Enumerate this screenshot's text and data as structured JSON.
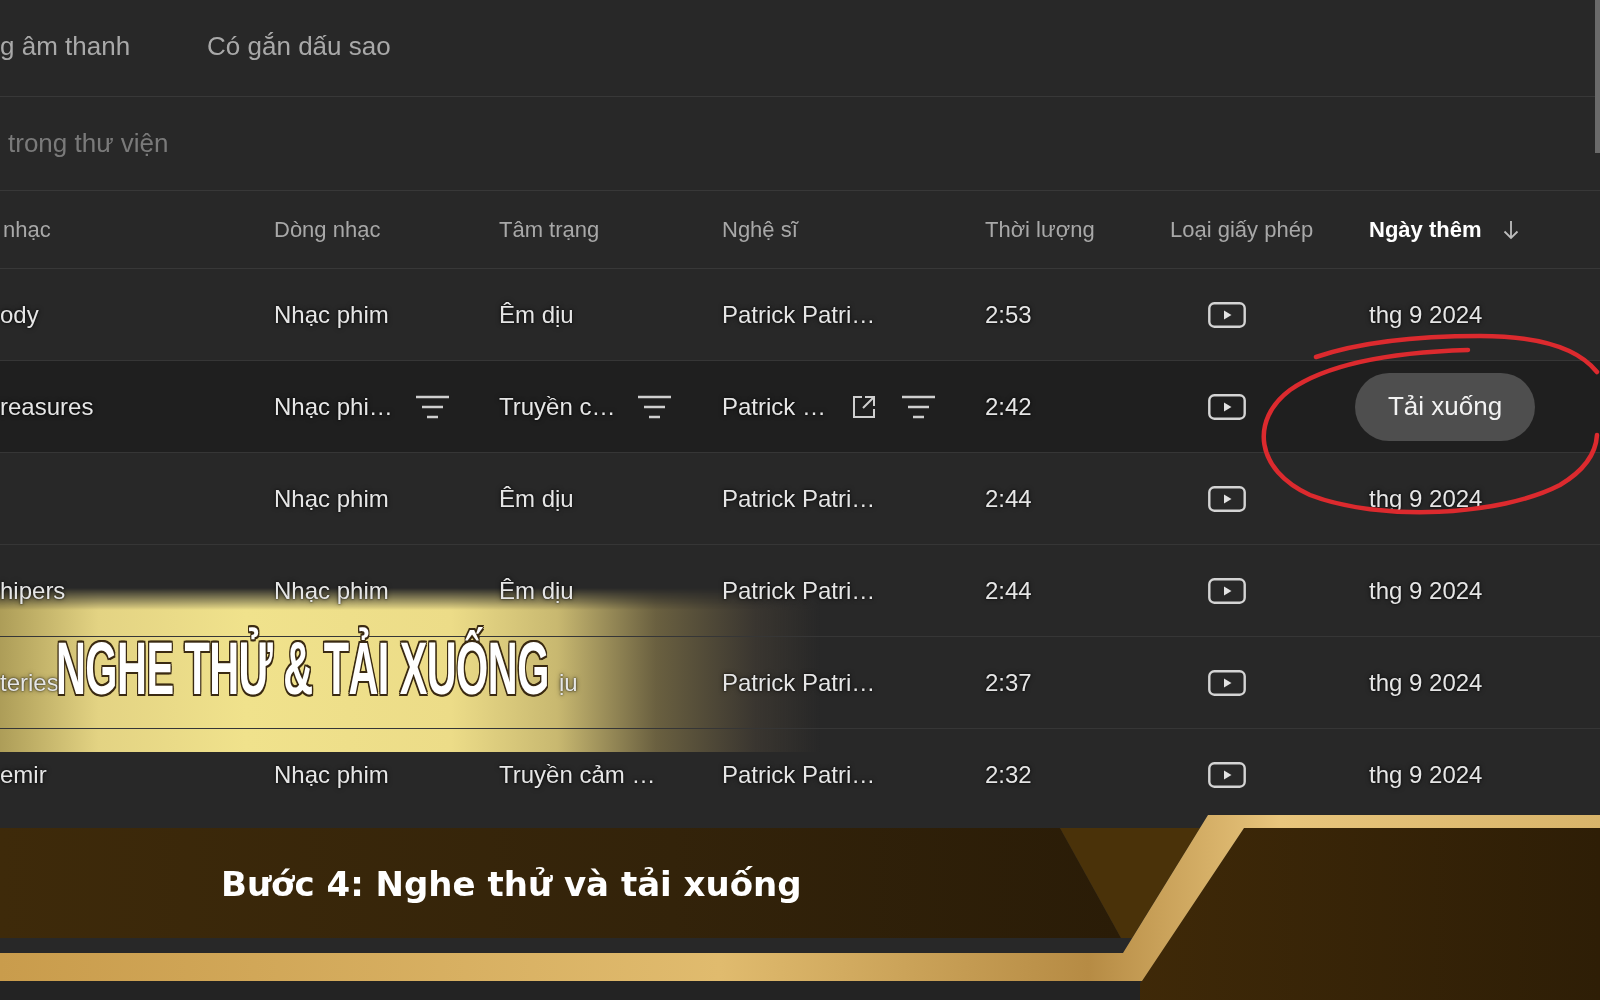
{
  "tabs": [
    {
      "label": "g âm thanh",
      "selected": false
    },
    {
      "label": "Có gắn dấu sao",
      "selected": false
    }
  ],
  "search": {
    "placeholder": "trong thư viện"
  },
  "table": {
    "columns": [
      {
        "label": "nhạc",
        "sorted": false
      },
      {
        "label": "Dòng nhạc",
        "sorted": false
      },
      {
        "label": "Tâm trạng",
        "sorted": false
      },
      {
        "label": "Nghệ sĩ",
        "sorted": false
      },
      {
        "label": "Thời lượng",
        "sorted": false
      },
      {
        "label": "Loại giấy phép",
        "sorted": false
      },
      {
        "label": "Ngày thêm",
        "sorted": true
      }
    ],
    "rows": [
      {
        "title": "ody",
        "genre": "Nhạc phim",
        "mood": "Êm dịu",
        "artist": "Patrick Patri…",
        "duration": "2:53",
        "date": "thg 9 2024",
        "hovered": false
      },
      {
        "title": "reasures",
        "genre": "Nhạc phi…",
        "mood": "Truyền c…",
        "artist": "Patrick …",
        "duration": "2:42",
        "download": "Tải xuống",
        "hovered": true
      },
      {
        "genre": "Nhạc phim",
        "mood": "Êm dịu",
        "artist": "Patrick Patri…",
        "duration": "2:44",
        "date": "thg 9 2024",
        "hovered": false
      },
      {
        "title": "hipers",
        "genre": "Nhạc phim",
        "mood": "Êm dịu",
        "artist": "Patrick Patri…",
        "duration": "2:44",
        "date": "thg 9 2024",
        "hovered": false
      },
      {
        "title": "teries",
        "mood": "ịu",
        "mood_covered": true,
        "artist": "Patrick Patri…",
        "duration": "2:37",
        "date": "thg 9 2024",
        "hovered": false
      },
      {
        "title": "emir",
        "genre": "Nhạc phim",
        "mood": "Truyền cảm …",
        "artist": "Patrick Patri…",
        "duration": "2:32",
        "date": "thg 9 2024",
        "hovered": false
      }
    ]
  },
  "overlay_banner": {
    "headline": "NGHE THỬ & TẢI XUỐNG"
  },
  "footer": {
    "caption": "Bước 4: Nghe thử và tải xuống"
  }
}
